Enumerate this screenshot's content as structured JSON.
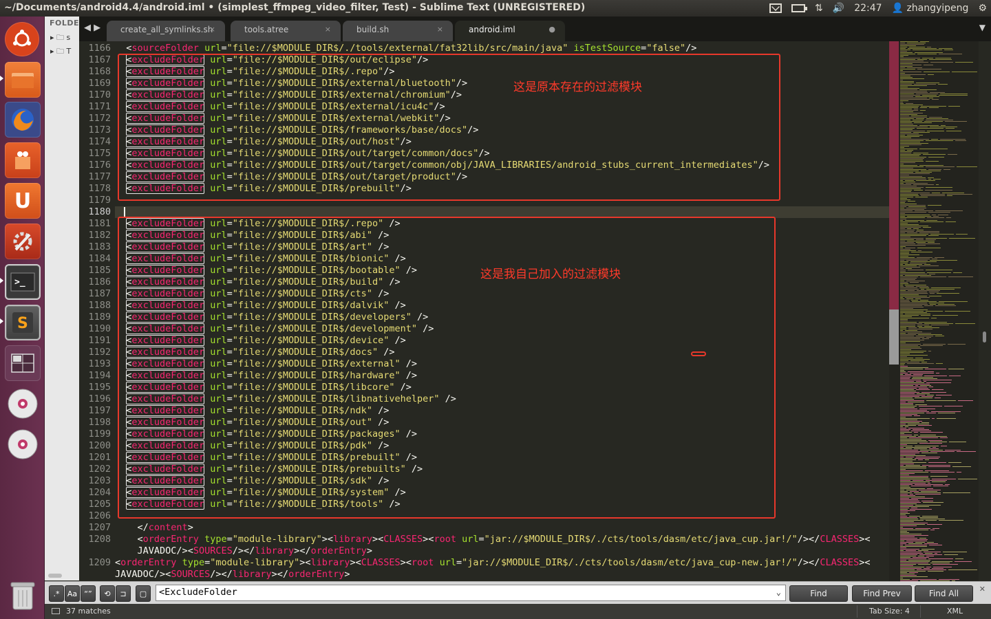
{
  "window": {
    "title": "~/Documents/android4.4/android.iml • (simplest_ffmpeg_video_filter, Test) - Sublime Text (UNREGISTERED)"
  },
  "tray": {
    "clock": "22:47",
    "user": "zhangyipeng"
  },
  "sidebar": {
    "header": "FOLDE",
    "items": [
      "s",
      "T"
    ]
  },
  "tabs": [
    {
      "label": "create_all_symlinks.sh",
      "close": "×"
    },
    {
      "label": "tools.atree",
      "close": "×"
    },
    {
      "label": "build.sh",
      "close": "×"
    },
    {
      "label": "android.iml",
      "close": "●"
    }
  ],
  "annotations": {
    "top": "这是原本存在的过滤模块",
    "bottom": "这是我自己加入的过滤模块"
  },
  "code": {
    "first_line": {
      "n": "1166",
      "indent": "",
      "tag": "sourceFolder",
      "mid": " url=\"file://$MODULE_DIR$/./tools/external/fat32lib/src/main/java\" isTestSource=\"false\"/>"
    },
    "original_excludes": [
      {
        "n": "1167",
        "path": "url=\"file://$MODULE_DIR$/out/eclipse\"/>"
      },
      {
        "n": "1168",
        "path": "url=\"file://$MODULE_DIR$/.repo\"/>"
      },
      {
        "n": "1169",
        "path": "url=\"file://$MODULE_DIR$/external/bluetooth\"/>"
      },
      {
        "n": "1170",
        "path": "url=\"file://$MODULE_DIR$/external/chromium\"/>"
      },
      {
        "n": "1171",
        "path": "url=\"file://$MODULE_DIR$/external/icu4c\"/>"
      },
      {
        "n": "1172",
        "path": "url=\"file://$MODULE_DIR$/external/webkit\"/>"
      },
      {
        "n": "1173",
        "path": "url=\"file://$MODULE_DIR$/frameworks/base/docs\"/>"
      },
      {
        "n": "1174",
        "path": "url=\"file://$MODULE_DIR$/out/host\"/>"
      },
      {
        "n": "1175",
        "path": "url=\"file://$MODULE_DIR$/out/target/common/docs\"/>"
      },
      {
        "n": "1176",
        "path": "url=\"file://$MODULE_DIR$/out/target/common/obj/JAVA_LIBRARIES/android_stubs_current_intermediates\"/>"
      },
      {
        "n": "1177",
        "path": "url=\"file://$MODULE_DIR$/out/target/product\"/>"
      },
      {
        "n": "1178",
        "path": "url=\"file://$MODULE_DIR$/prebuilt\"/>"
      }
    ],
    "blank_lines": [
      "1179",
      "1180"
    ],
    "added_excludes": [
      {
        "n": "1181",
        "path": "url=\"file://$MODULE_DIR$/.repo\" />"
      },
      {
        "n": "1182",
        "path": "url=\"file://$MODULE_DIR$/abi\" />"
      },
      {
        "n": "1183",
        "path": "url=\"file://$MODULE_DIR$/art\" />"
      },
      {
        "n": "1184",
        "path": "url=\"file://$MODULE_DIR$/bionic\" />"
      },
      {
        "n": "1185",
        "path": "url=\"file://$MODULE_DIR$/bootable\" />"
      },
      {
        "n": "1186",
        "path": "url=\"file://$MODULE_DIR$/build\" />"
      },
      {
        "n": "1187",
        "path": "url=\"file://$MODULE_DIR$/cts\" />"
      },
      {
        "n": "1188",
        "path": "url=\"file://$MODULE_DIR$/dalvik\" />"
      },
      {
        "n": "1189",
        "path": "url=\"file://$MODULE_DIR$/developers\" />"
      },
      {
        "n": "1190",
        "path": "url=\"file://$MODULE_DIR$/development\" />"
      },
      {
        "n": "1191",
        "path": "url=\"file://$MODULE_DIR$/device\" />"
      },
      {
        "n": "1192",
        "path": "url=\"file://$MODULE_DIR$/docs\" />"
      },
      {
        "n": "1193",
        "path": "url=\"file://$MODULE_DIR$/external\" />"
      },
      {
        "n": "1194",
        "path": "url=\"file://$MODULE_DIR$/hardware\" />"
      },
      {
        "n": "1195",
        "path": "url=\"file://$MODULE_DIR$/libcore\" />"
      },
      {
        "n": "1196",
        "path": "url=\"file://$MODULE_DIR$/libnativehelper\" />"
      },
      {
        "n": "1197",
        "path": "url=\"file://$MODULE_DIR$/ndk\" />"
      },
      {
        "n": "1198",
        "path": "url=\"file://$MODULE_DIR$/out\" />"
      },
      {
        "n": "1199",
        "path": "url=\"file://$MODULE_DIR$/packages\" />"
      },
      {
        "n": "1200",
        "path": "url=\"file://$MODULE_DIR$/pdk\" />"
      },
      {
        "n": "1201",
        "path": "url=\"file://$MODULE_DIR$/prebuilt\" />"
      },
      {
        "n": "1202",
        "path": "url=\"file://$MODULE_DIR$/prebuilts\" />"
      },
      {
        "n": "1203",
        "path": "url=\"file://$MODULE_DIR$/sdk\" />"
      },
      {
        "n": "1204",
        "path": "url=\"file://$MODULE_DIR$/system\" />"
      },
      {
        "n": "1205",
        "path": "url=\"file://$MODULE_DIR$/tools\" />"
      }
    ],
    "exclude_tag": "excludeFolder",
    "trailing": [
      {
        "n": "1206",
        "text": ""
      },
      {
        "n": "1207",
        "text": "    </content>"
      },
      {
        "n": "1208",
        "text": "    <orderEntry type=\"module-library\"><library><CLASSES><root url=\"jar://$MODULE_DIR$/./cts/tools/dasm/etc/java_cup.jar!/\"/></CLASSES><"
      },
      {
        "n": "",
        "text": "    JAVADOC/><SOURCES/></library></orderEntry>"
      },
      {
        "n": "1209",
        "text": "<orderEntry type=\"module-library\"><library><CLASSES><root url=\"jar://$MODULE_DIR$/./cts/tools/dasm/etc/java_cup-new.jar!/\"/></CLASSES><"
      },
      {
        "n": "",
        "text": "JAVADOC/><SOURCES/></library></orderEntry>"
      }
    ]
  },
  "find": {
    "case_label": "Aa",
    "word_label": "“”",
    "query": "<ExcludeFolder",
    "find": "Find",
    "find_prev": "Find Prev",
    "find_all": "Find All"
  },
  "status": {
    "matches": "37 matches",
    "tab_size": "Tab Size: 4",
    "syntax": "XML"
  },
  "colors": {
    "tag": "#f92672",
    "attr": "#a6e22e",
    "string": "#e6db74",
    "annotation_red": "#e8382b",
    "launcher": "#5b2843"
  }
}
